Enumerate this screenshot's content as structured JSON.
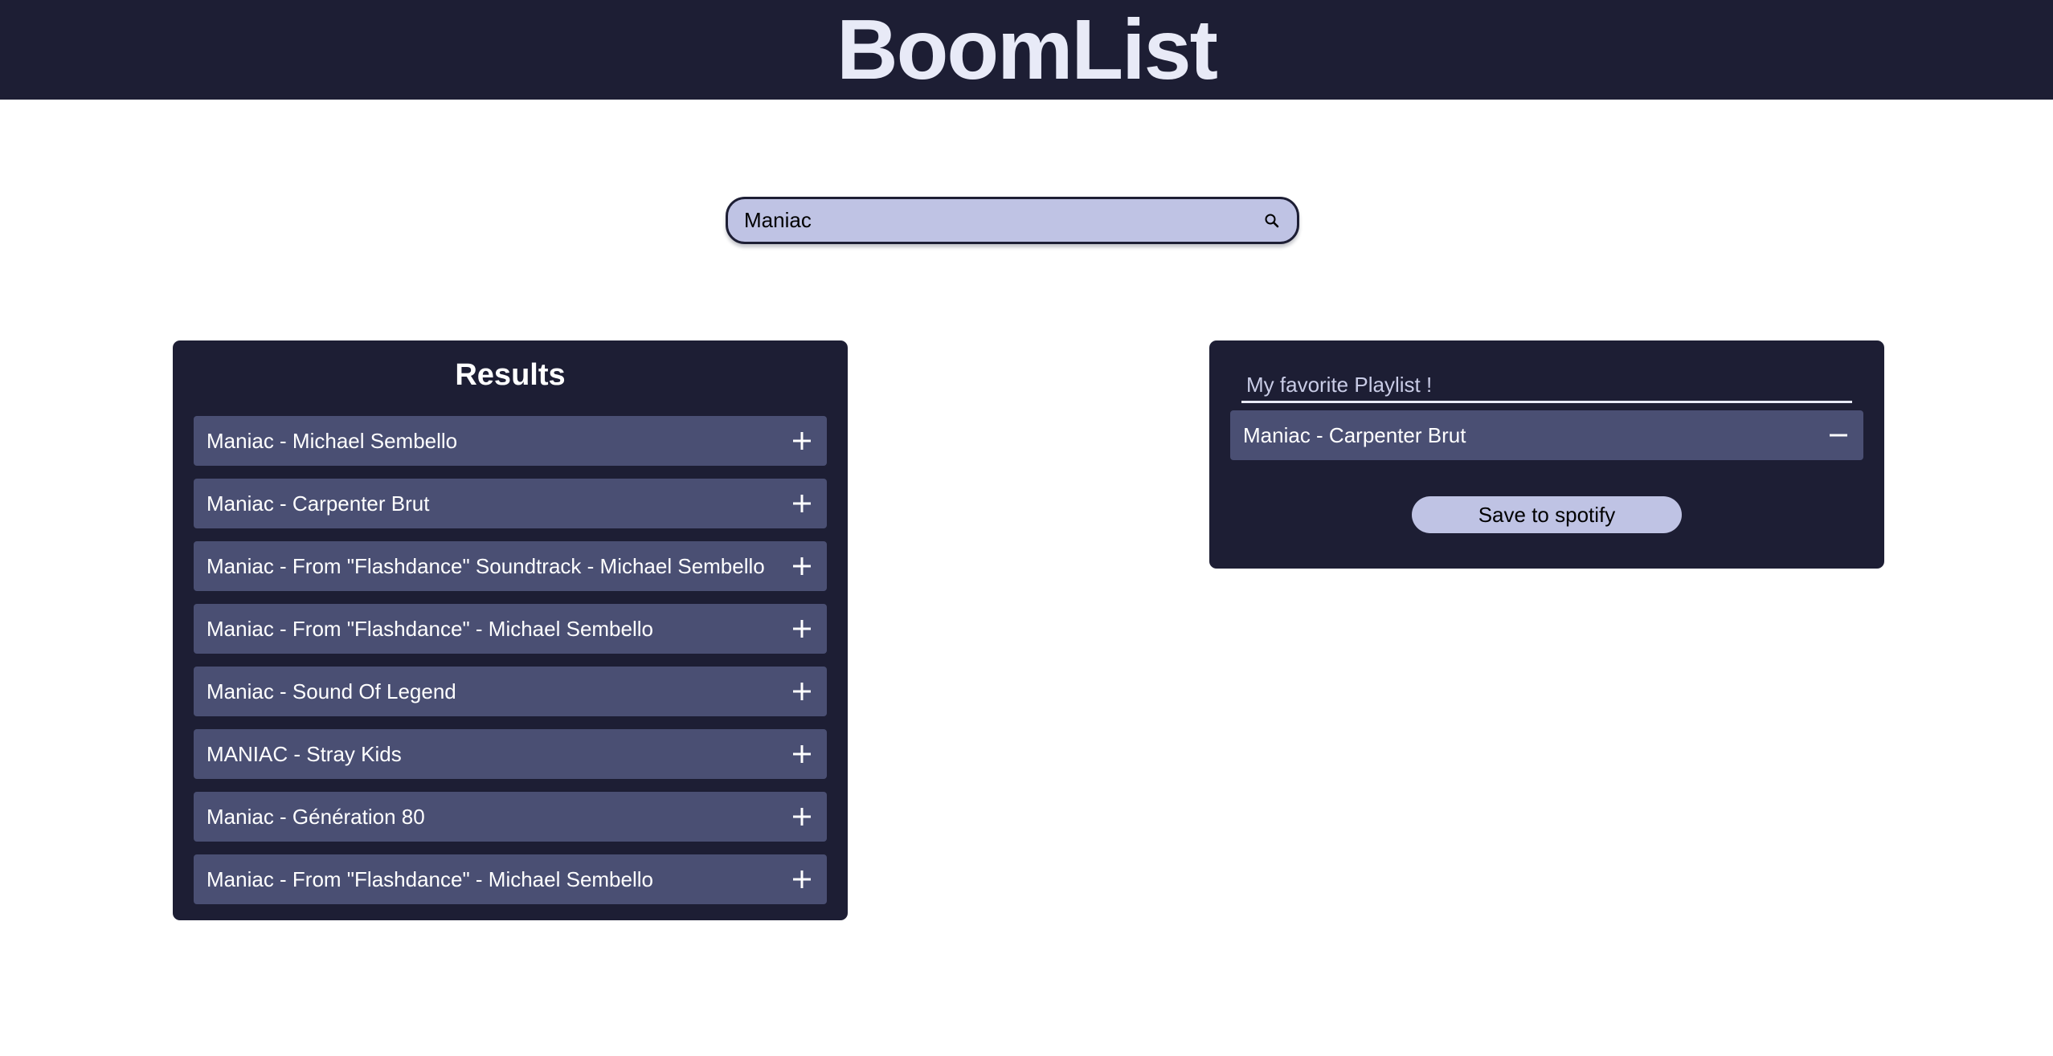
{
  "app": {
    "title": "BoomList"
  },
  "search": {
    "value": "Maniac",
    "icon": "search-icon"
  },
  "results": {
    "title": "Results",
    "items": [
      {
        "label": "Maniac - Michael Sembello"
      },
      {
        "label": "Maniac - Carpenter Brut"
      },
      {
        "label": "Maniac - From \"Flashdance\" Soundtrack - Michael Sembello"
      },
      {
        "label": "Maniac - From \"Flashdance\" - Michael Sembello"
      },
      {
        "label": "Maniac - Sound Of Legend"
      },
      {
        "label": "MANIAC - Stray Kids"
      },
      {
        "label": "Maniac - Génération 80"
      },
      {
        "label": "Maniac - From \"Flashdance\" - Michael Sembello"
      }
    ],
    "action_icon": "plus-icon"
  },
  "playlist": {
    "name": "My favorite Playlist !",
    "items": [
      {
        "label": "Maniac - Carpenter Brut"
      }
    ],
    "action_icon": "minus-icon",
    "save_label": "Save to spotify"
  },
  "colors": {
    "header_bg": "#1d1e34",
    "panel_bg": "#1d1e34",
    "track_bg": "#4a4f73",
    "accent": "#bfc3e4"
  }
}
